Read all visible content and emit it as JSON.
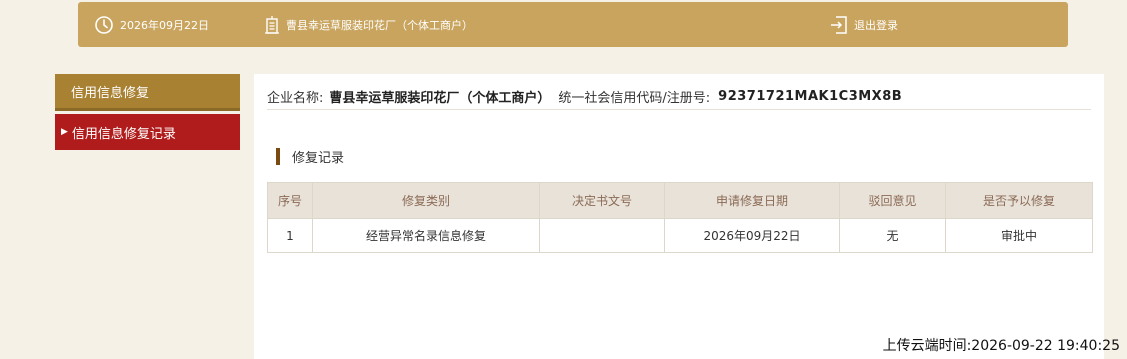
{
  "header": {
    "date": "2026年09月22日",
    "company": "曹县幸运草服装印花厂（个体工商户）",
    "logout_label": "退出登录",
    "accent_color": "#c9a45e"
  },
  "sidebar": {
    "section_label": "信用信息修复",
    "items": [
      {
        "label": "信用信息修复记录",
        "active": true
      }
    ]
  },
  "company_info": {
    "name_label": "企业名称:",
    "name": "曹县幸运草服装印花厂（个体工商户）",
    "code_label": "统一社会信用代码/注册号:",
    "code": "92371721MAK1C3MX8B"
  },
  "section_title": "修复记录",
  "table": {
    "headers": [
      "序号",
      "修复类别",
      "决定书文号",
      "申请修复日期",
      "驳回意见",
      "是否予以修复"
    ],
    "rows": [
      [
        "1",
        "经营异常名录信息修复",
        "",
        "2026年09月22日",
        "无",
        "审批中"
      ]
    ]
  },
  "upload_time": "上传云端时间:2026-09-22 19:40:25"
}
